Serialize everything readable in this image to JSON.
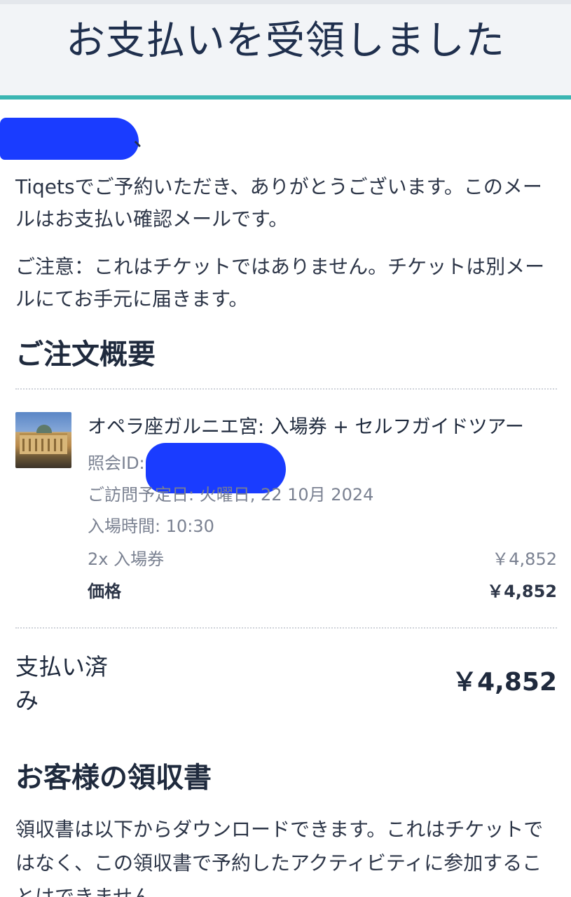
{
  "header": {
    "title": "お支払いを受領しました"
  },
  "greeting": {
    "suffix": "、"
  },
  "intro": {
    "thanks": "Tiqetsでご予約いただき、ありがとうございます。このメールはお支払い確認メールです。",
    "notice": "ご注意：これはチケットではありません。チケットは別メールにてお手元に届きます。"
  },
  "summary": {
    "heading": "ご注文概要",
    "item": {
      "title": "オペラ座ガルニエ宮: 入場券 + セルフガイドツアー",
      "reference_label": "照会ID:",
      "visit_date": "ご訪問予定日: 火曜日, 22 10月 2024",
      "entry_time": "入場時間: 10:30",
      "quantity_line": "2x 入場券",
      "quantity_amount": "￥4,852",
      "price_label": "価格",
      "price_amount": "￥4,852"
    }
  },
  "payment": {
    "paid_label": "支払い済み",
    "paid_amount": "￥4,852"
  },
  "receipt": {
    "heading": "お客様の領収書",
    "text": "領収書は以下からダウンロードできます。これはチケットではなく、この領収書で予約したアクティビティに参加することはできません。"
  },
  "colors": {
    "accent": "#3bb6b3",
    "redaction": "#1a3cff",
    "header_bg": "#f2f4f7"
  }
}
